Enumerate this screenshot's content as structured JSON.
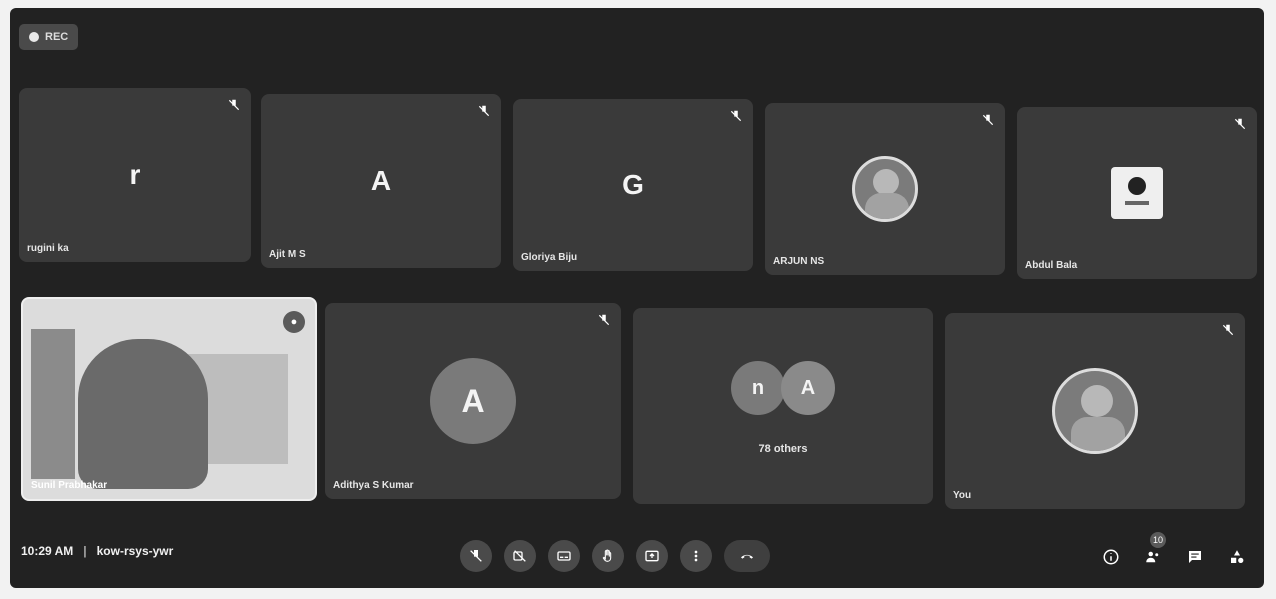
{
  "status": {
    "rec_label": "REC"
  },
  "participants": [
    {
      "name": "rugini ka",
      "initial": "r"
    },
    {
      "name": "Ajit M S",
      "initial": "A"
    },
    {
      "name": "Gloriya Biju",
      "initial": "G"
    },
    {
      "name": "ARJUN NS",
      "initial": ""
    },
    {
      "name": "Abdul Bala",
      "initial": ""
    },
    {
      "name": "Sunil Prabhakar",
      "initial": ""
    },
    {
      "name": "Adithya S Kumar",
      "initial": "A"
    },
    {
      "name": "78 others",
      "initial_1": "n",
      "initial_2": "A"
    },
    {
      "name": "You",
      "initial": ""
    }
  ],
  "footer": {
    "time": "10:29 AM",
    "meeting_code": "kow-rsys-ywr",
    "participants_badge": "10"
  }
}
